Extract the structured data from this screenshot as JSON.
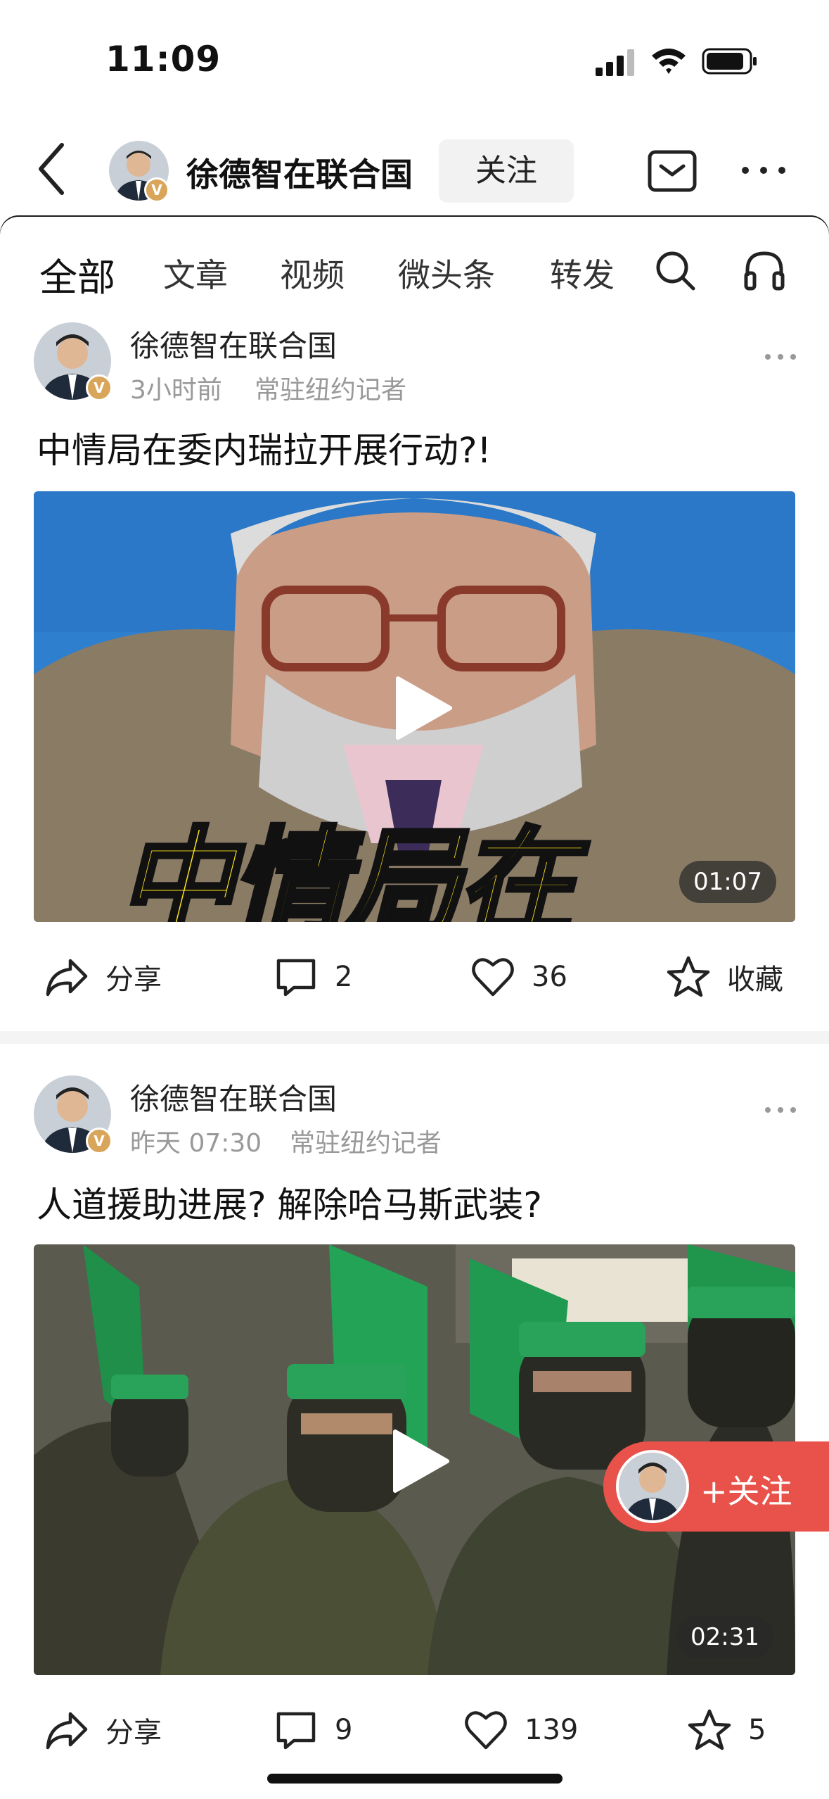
{
  "status_bar": {
    "time": "11:09"
  },
  "header": {
    "title": "徐德智在联合国",
    "follow_label": "关注",
    "avatar_badge": "V"
  },
  "tabs": [
    {
      "label": "全部",
      "active": true
    },
    {
      "label": "文章"
    },
    {
      "label": "视频"
    },
    {
      "label": "微头条"
    },
    {
      "label": "转发"
    }
  ],
  "posts": [
    {
      "author": "徐德智在联合国",
      "badge": "V",
      "time": "3小时前",
      "role": "常驻纽约记者",
      "title": "中情局在委内瑞拉开展行动?!",
      "video_overlay_text": "中情局在",
      "duration": "01:07",
      "share_label": "分享",
      "comments": "2",
      "likes": "36",
      "favorite_label": "收藏"
    },
    {
      "author": "徐德智在联合国",
      "badge": "V",
      "time": "昨天 07:30",
      "role": "常驻纽约记者",
      "title": "人道援助进展? 解除哈马斯武装?",
      "duration": "02:31",
      "share_label": "分享",
      "comments": "9",
      "likes": "139",
      "favorites": "5"
    }
  ],
  "floating_follow": {
    "label": "+关注"
  },
  "colors": {
    "accent": "#e8524a",
    "badge": "#d9a55a",
    "meta": "#999999"
  },
  "icons": [
    "back-icon",
    "mail-icon",
    "more-icon",
    "search-icon",
    "headphones-icon",
    "play-icon",
    "share-icon",
    "comment-icon",
    "heart-icon",
    "star-icon",
    "signal-icon",
    "wifi-icon",
    "battery-icon"
  ]
}
